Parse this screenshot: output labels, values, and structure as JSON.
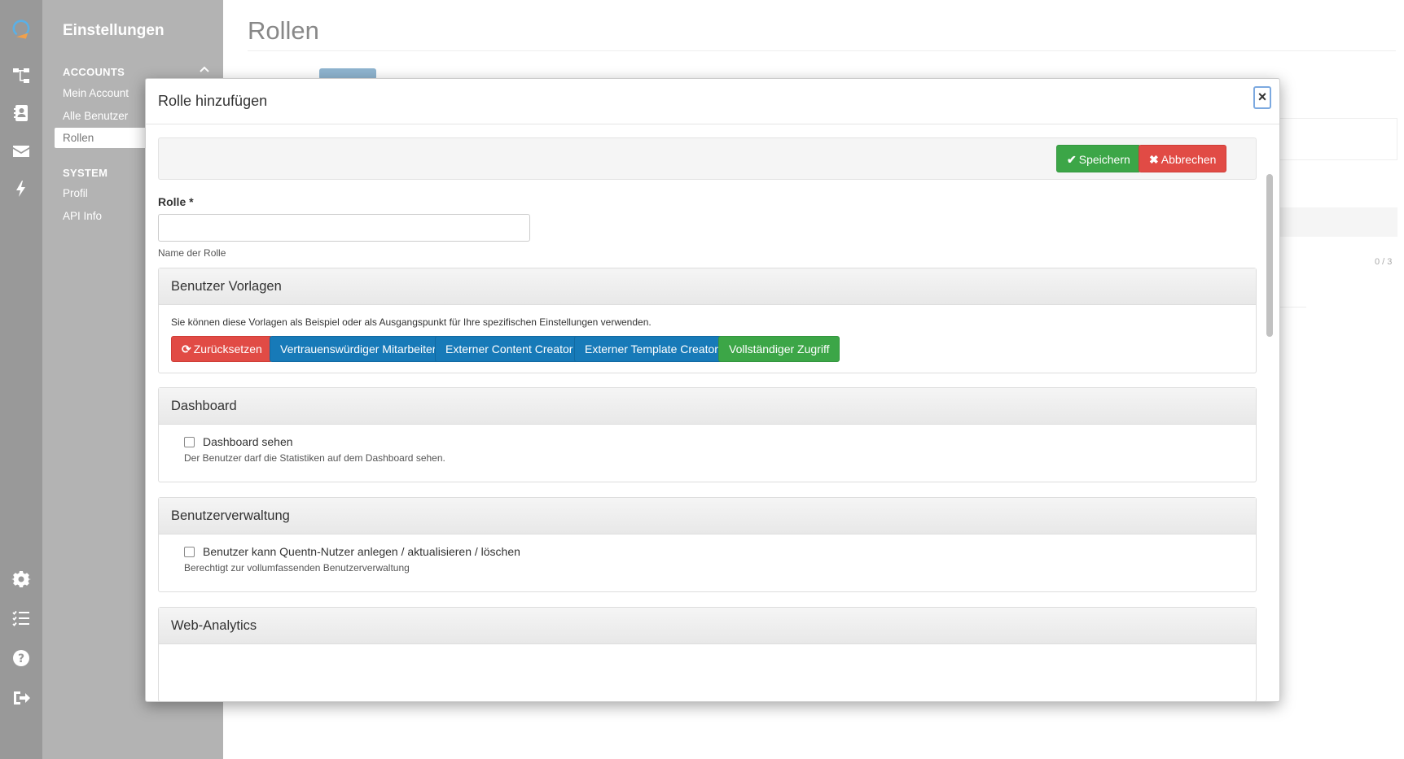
{
  "rail": {
    "icons": [
      "logo-icon",
      "sitemap-icon",
      "contacts-icon",
      "envelope-icon",
      "bolt-icon",
      "gear-icon",
      "tasks-icon",
      "help-icon",
      "logout-icon"
    ]
  },
  "sidebar": {
    "title": "Einstellungen",
    "sections": [
      {
        "label": "ACCOUNTS",
        "items": [
          "Mein Account",
          "Alle Benutzer",
          "Rollen"
        ]
      },
      {
        "label": "SYSTEM",
        "items": [
          "Profil",
          "API Info"
        ]
      }
    ],
    "active_item": "Rollen"
  },
  "page": {
    "title": "Rollen",
    "count": "0 / 3"
  },
  "modal": {
    "title": "Rolle hinzufügen",
    "close": "×",
    "save_label": "Speichern",
    "cancel_label": "Abbrechen",
    "role_label": "Rolle *",
    "role_value": "",
    "role_help": "Name der Rolle",
    "templates": {
      "heading": "Benutzer Vorlagen",
      "text": "Sie können diese Vorlagen als Beispiel oder als Ausgangspunkt für Ihre spezifischen Einstellungen verwenden.",
      "buttons": [
        "Zurücksetzen",
        "Vertrauenswürdiger Mitarbeiter",
        "Externer Content Creator",
        "Externer Template Creator",
        "Vollständiger Zugriff"
      ]
    },
    "dashboard": {
      "heading": "Dashboard",
      "checkbox_label": "Dashboard sehen",
      "checked": false,
      "help": "Der Benutzer darf die Statistiken auf dem Dashboard sehen."
    },
    "user_management": {
      "heading": "Benutzerverwaltung",
      "checkbox_label": "Benutzer kann Quentn-Nutzer anlegen / aktualisieren / löschen",
      "checked": false,
      "help": "Berechtigt zur vollumfassenden Benutzerverwaltung"
    },
    "web_analytics": {
      "heading": "Web-Analytics"
    }
  },
  "colors": {
    "success": "#3ca647",
    "danger": "#e14b45",
    "primary": "#177ab8",
    "rail": "#999999",
    "sidebar": "#b3b3b3"
  }
}
